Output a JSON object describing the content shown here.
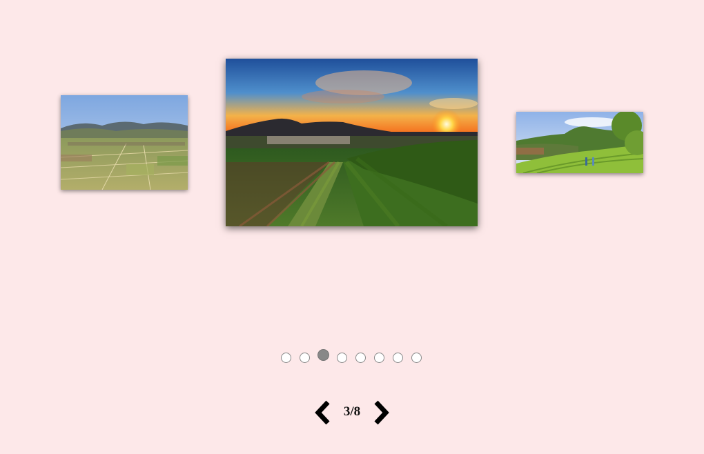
{
  "gallery": {
    "slides": [
      {
        "name": "vineyard-valley-aerial",
        "position": "left"
      },
      {
        "name": "vineyard-sunset",
        "position": "center"
      },
      {
        "name": "vineyard-hill-walkers",
        "position": "right"
      }
    ],
    "current": 3,
    "total": 8
  },
  "pager": {
    "counter_text": "3/8",
    "prev_icon": "chevron-left-icon",
    "next_icon": "chevron-right-icon"
  },
  "dots": {
    "count": 8,
    "active_index": 2
  },
  "colors": {
    "background": "#fde8e9",
    "dot_inactive": "#ffffff",
    "dot_active": "#888888",
    "arrow": "#000000"
  }
}
